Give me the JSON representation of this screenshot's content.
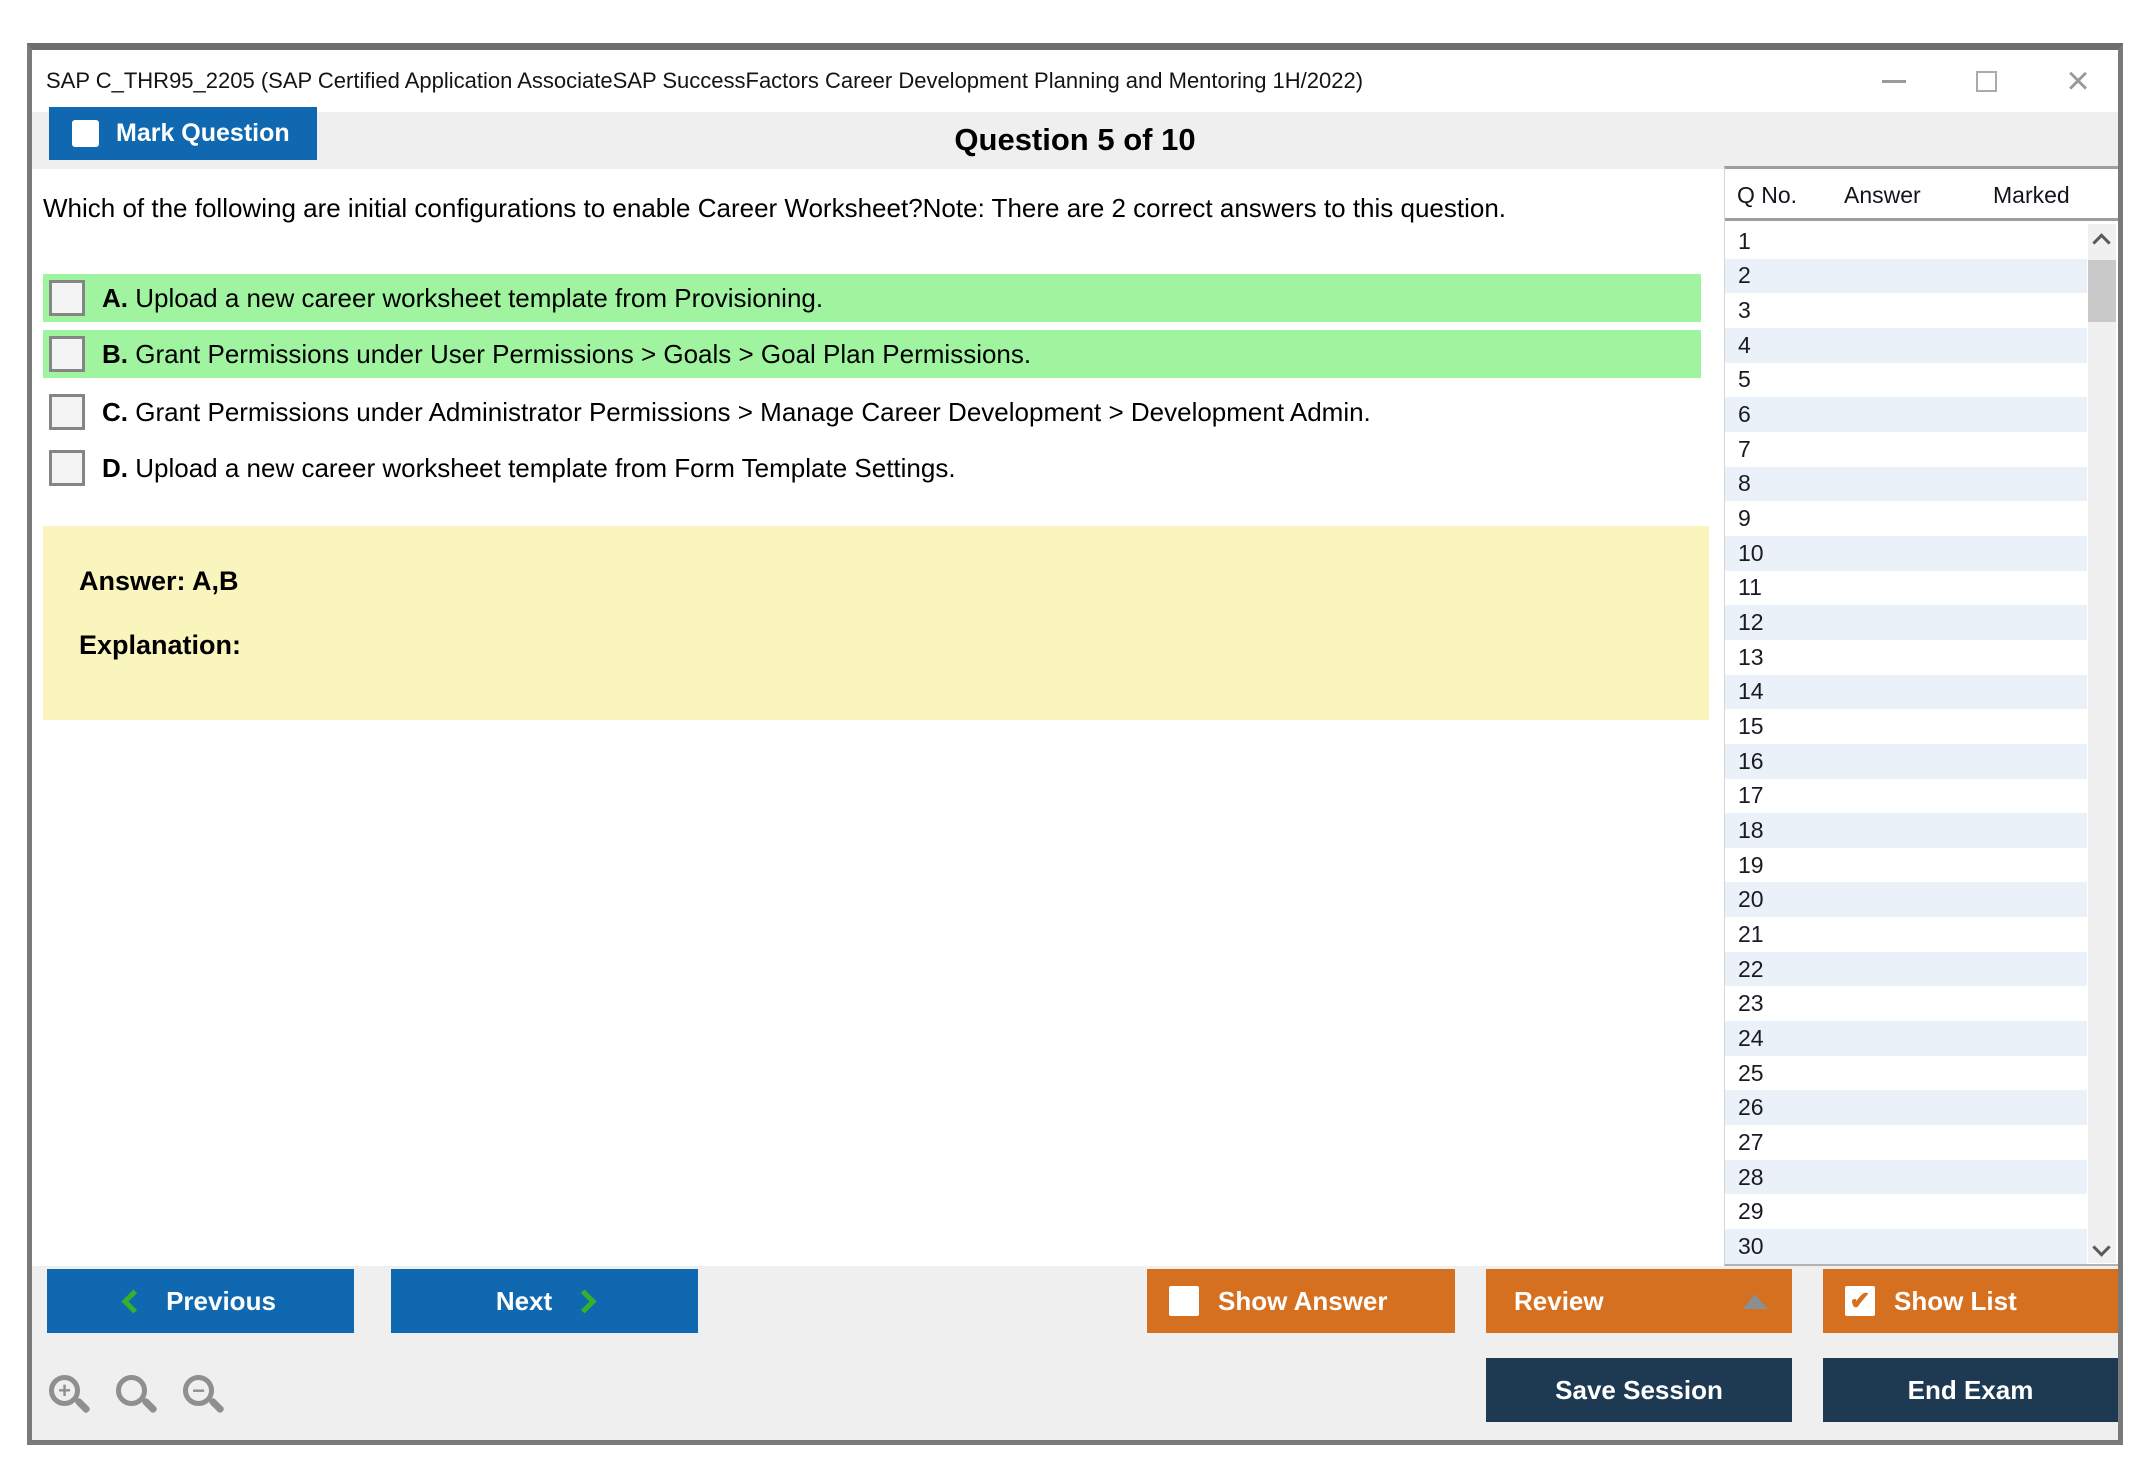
{
  "window": {
    "title": "SAP C_THR95_2205 (SAP Certified Application AssociateSAP SuccessFactors Career Development Planning and Mentoring 1H/2022)"
  },
  "header": {
    "mark_question_label": "Mark Question",
    "question_counter": "Question 5 of 10"
  },
  "question": {
    "text": "Which of the following are initial configurations to enable Career Worksheet?Note: There are 2 correct answers to this question.",
    "options": [
      {
        "letter": "A",
        "text": "Upload a new career worksheet template from Provisioning.",
        "highlighted": true,
        "checked": false
      },
      {
        "letter": "B",
        "text": "Grant Permissions under User Permissions > Goals > Goal Plan Permissions.",
        "highlighted": true,
        "checked": false
      },
      {
        "letter": "C",
        "text": "Grant Permissions under Administrator Permissions > Manage Career Development > Development Admin.",
        "highlighted": false,
        "checked": false
      },
      {
        "letter": "D",
        "text": "Upload a new career worksheet template from Form Template Settings.",
        "highlighted": false,
        "checked": false
      }
    ],
    "answer_label": "Answer: A,B",
    "explanation_label": "Explanation:"
  },
  "question_list": {
    "columns": [
      "Q No.",
      "Answer",
      "Marked"
    ],
    "visible_rows": [
      1,
      2,
      3,
      4,
      5,
      6,
      7,
      8,
      9,
      10,
      11,
      12,
      13,
      14,
      15,
      16,
      17,
      18,
      19,
      20,
      21,
      22,
      23,
      24,
      25,
      26,
      27,
      28,
      29,
      30
    ]
  },
  "footer": {
    "previous_label": "Previous",
    "next_label": "Next",
    "show_answer_label": "Show Answer",
    "review_label": "Review",
    "show_list_label": "Show List",
    "save_session_label": "Save Session",
    "end_exam_label": "End Exam",
    "show_answer_checked": false,
    "show_list_checked": true
  },
  "icons": {
    "close": "×",
    "check": "✔"
  },
  "colors": {
    "accent_blue": "#1068b0",
    "accent_orange": "#d4701f",
    "dark_navy": "#1d3a52",
    "highlight_green": "#a0f4a0",
    "explanation_yellow": "#faf5bd",
    "row_alt_blue": "#eaf1f8",
    "chevron_green": "#35b229"
  }
}
